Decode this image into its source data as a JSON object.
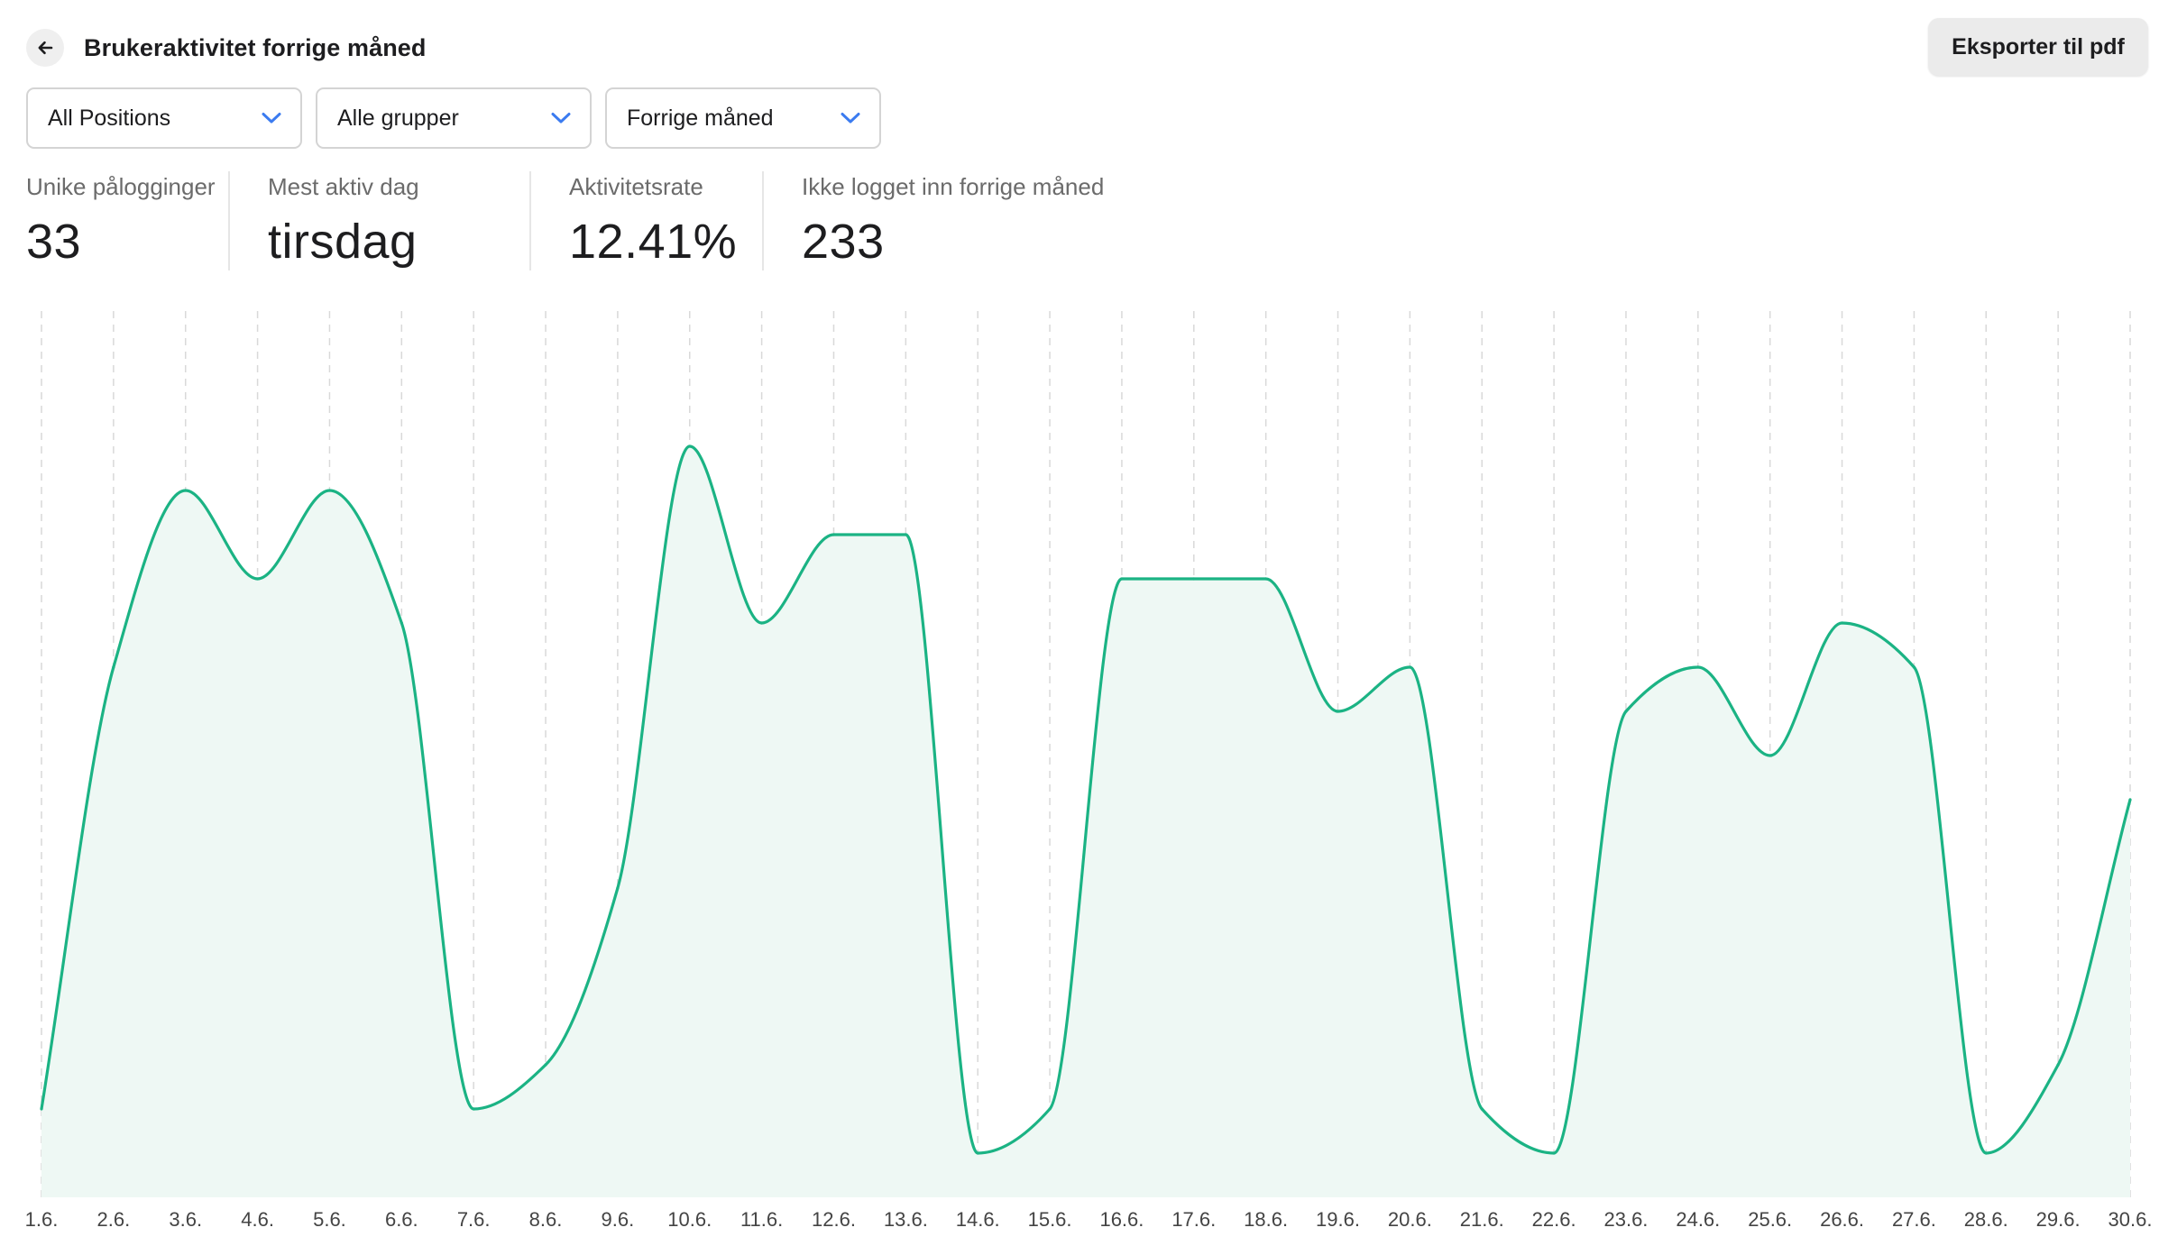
{
  "header": {
    "title": "Brukeraktivitet forrige måned",
    "back_icon": "arrow-left-icon",
    "export_label": "Eksporter til pdf"
  },
  "filters": [
    {
      "value": "All Positions",
      "icon": "chevron-down-icon"
    },
    {
      "value": "Alle grupper",
      "icon": "chevron-down-icon"
    },
    {
      "value": "Forrige måned",
      "icon": "chevron-down-icon"
    }
  ],
  "stats": [
    {
      "label": "Unike pålogginger",
      "value": "33"
    },
    {
      "label": "Mest aktiv dag",
      "value": "tirsdag"
    },
    {
      "label": "Aktivitetsrate",
      "value": "12.41%"
    },
    {
      "label": "Ikke logget inn forrige måned",
      "value": "233"
    }
  ],
  "colors": {
    "line": "#1bb384",
    "area": "#eef8f4",
    "accent": "#3b7bf0",
    "grid": "#d9d9d9"
  },
  "chart_data": {
    "type": "area",
    "categories": [
      "1.6.",
      "2.6.",
      "3.6.",
      "4.6.",
      "5.6.",
      "6.6.",
      "7.6.",
      "8.6.",
      "9.6.",
      "10.6.",
      "11.6.",
      "12.6.",
      "13.6.",
      "14.6.",
      "15.6.",
      "16.6.",
      "17.6.",
      "18.6.",
      "19.6.",
      "20.6.",
      "21.6.",
      "22.6.",
      "23.6.",
      "24.6.",
      "25.6.",
      "26.6.",
      "27.6.",
      "28.6.",
      "29.6.",
      "30.6."
    ],
    "values": [
      2,
      12,
      16,
      14,
      16,
      13,
      2,
      3,
      7,
      17,
      13,
      15,
      15,
      1,
      2,
      14,
      14,
      14,
      11,
      12,
      2,
      1,
      11,
      12,
      10,
      13,
      12,
      1,
      3,
      9
    ],
    "ylim": [
      0,
      20
    ],
    "grid": "vertical dashed",
    "y_axis_labels": false
  }
}
